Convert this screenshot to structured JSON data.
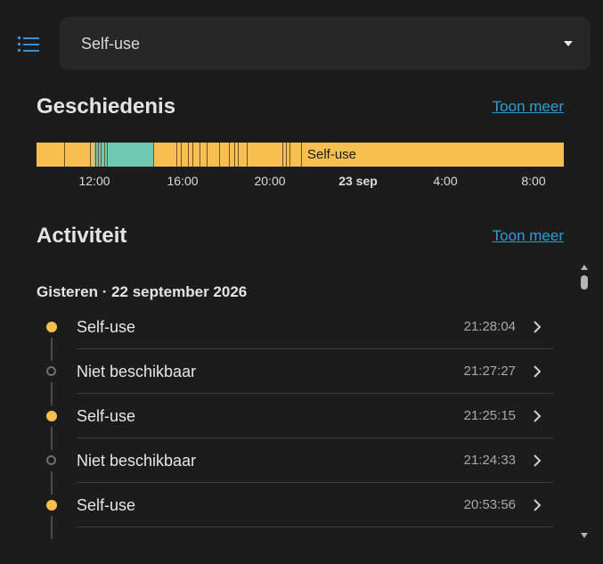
{
  "header": {
    "menu_icon": "list-icon",
    "select_value": "Self-use"
  },
  "history": {
    "title": "Geschiedenis",
    "more_label": "Toon meer",
    "timeline_label": "Self-use",
    "colors": {
      "self_use": "#f7bf4f",
      "other": "#6fcab3"
    },
    "axis_labels": [
      "12:00",
      "16:00",
      "20:00",
      "23 sep",
      "4:00",
      "8:00"
    ]
  },
  "activity": {
    "title": "Activiteit",
    "more_label": "Toon meer",
    "day_header": "Gisteren · 22 september 2026",
    "entries": [
      {
        "label": "Self-use",
        "time": "21:28:04",
        "state": "on"
      },
      {
        "label": "Niet beschikbaar",
        "time": "21:27:27",
        "state": "off"
      },
      {
        "label": "Self-use",
        "time": "21:25:15",
        "state": "on"
      },
      {
        "label": "Niet beschikbaar",
        "time": "21:24:33",
        "state": "off"
      },
      {
        "label": "Self-use",
        "time": "20:53:56",
        "state": "on"
      }
    ]
  }
}
